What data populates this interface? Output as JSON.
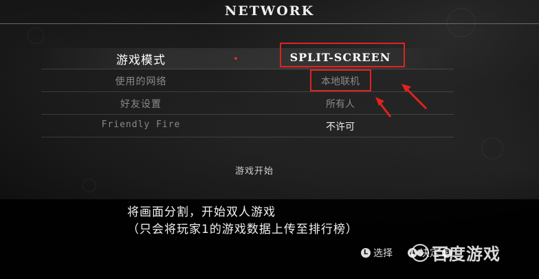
{
  "header": {
    "title": "NETWORK"
  },
  "menu": {
    "rows": [
      {
        "label": "游戏模式",
        "value": "SPLIT-SCREEN"
      },
      {
        "label": "使用的网络",
        "value": "本地联机"
      },
      {
        "label": "好友设置",
        "value": "所有人"
      },
      {
        "label": "Friendly Fire",
        "value": "不许可"
      }
    ],
    "start_label": "游戏开始"
  },
  "description": {
    "line1": "将画面分割，开始双人游戏",
    "line2": "（只会将玩家1的游戏数据上传至排行榜）"
  },
  "hints": {
    "select_icon": "L",
    "select_label": "选择",
    "confirm_icon": "A",
    "confirm_label": "决定",
    "third_icon": "B"
  },
  "watermark": {
    "text": "百度游戏",
    "icon": "baidu-paw-icon"
  },
  "colors": {
    "highlight_box": "#e0231e",
    "arrow": "#e0231e"
  }
}
